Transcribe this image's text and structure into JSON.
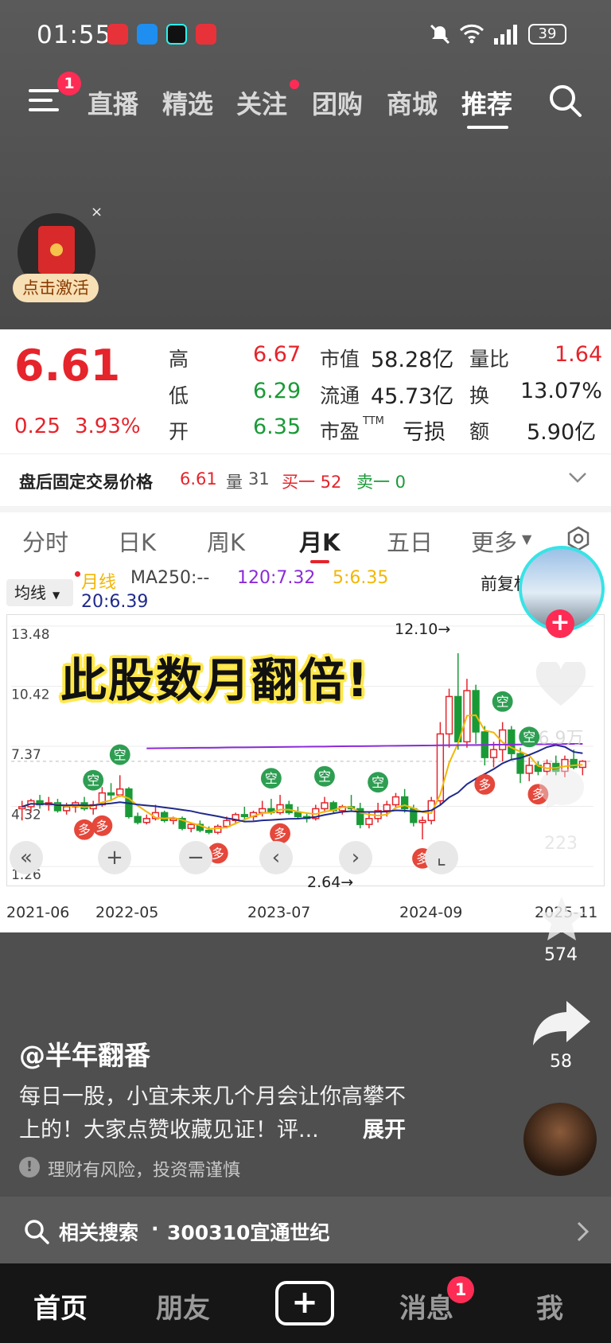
{
  "status": {
    "time": "01:55",
    "battery": "39"
  },
  "nav": {
    "tabs": [
      "直播",
      "精选",
      "关注",
      "团购",
      "商城",
      "推荐"
    ],
    "menu_badge": "1"
  },
  "promo": {
    "label": "点击激活"
  },
  "quote": {
    "price": "6.61",
    "change": "0.25",
    "change_pct": "3.93%",
    "high_label": "高",
    "high": "6.67",
    "low_label": "低",
    "low": "6.29",
    "open_label": "开",
    "open": "6.35",
    "mcap_label": "市值",
    "mcap": "58.28亿",
    "float_label": "流通",
    "float": "45.73亿",
    "pe_label": "市盈",
    "pe_sup": "TTM",
    "pe": "亏损",
    "vr_label": "量比",
    "vr": "1.64",
    "turn_label": "换",
    "turn": "13.07%",
    "amt_label": "额",
    "amt": "5.90亿"
  },
  "afterhours": {
    "label": "盘后固定交易价格",
    "price": "6.61",
    "vol_label": "量",
    "vol": "31",
    "bid": "买一 52",
    "ask": "卖一 0"
  },
  "chart_tabs": [
    "分时",
    "日K",
    "周K",
    "月K",
    "五日",
    "更多"
  ],
  "ma": {
    "selector": "均线",
    "line_label": "月线",
    "ma250": "MA250:--",
    "ma120": "120:7.32",
    "ma5": "5:6.35",
    "ma20": "20:6.39",
    "fq": "前复权"
  },
  "chart_data": {
    "type": "candlestick",
    "y_ticks": [
      "13.48",
      "10.42",
      "7.37",
      "4.32",
      "1.26"
    ],
    "ylim": [
      1.26,
      13.48
    ],
    "x_ticks": [
      "2021-06",
      "2022-05",
      "2023-07",
      "2024-09",
      "2025-11"
    ],
    "max_label": "12.10→",
    "min_label": "2.64→",
    "max": 12.1,
    "min": 2.64,
    "candles": [
      [
        4.2,
        4.6,
        3.6,
        4.3
      ],
      [
        4.3,
        4.7,
        4.0,
        4.6
      ],
      [
        4.6,
        4.9,
        4.2,
        4.4
      ],
      [
        4.4,
        4.8,
        4.1,
        4.5
      ],
      [
        4.5,
        4.7,
        4.0,
        4.1
      ],
      [
        4.1,
        4.5,
        3.9,
        4.3
      ],
      [
        4.3,
        4.6,
        4.0,
        4.5
      ],
      [
        4.5,
        4.8,
        4.1,
        4.2
      ],
      [
        4.2,
        4.6,
        3.9,
        4.4
      ],
      [
        4.4,
        5.3,
        4.3,
        5.0
      ],
      [
        5.0,
        5.5,
        4.6,
        4.9
      ],
      [
        4.9,
        5.9,
        4.8,
        5.2
      ],
      [
        5.2,
        5.3,
        3.7,
        3.8
      ],
      [
        3.8,
        4.0,
        3.4,
        3.5
      ],
      [
        3.5,
        3.9,
        3.4,
        3.7
      ],
      [
        3.7,
        4.4,
        3.6,
        4.0
      ],
      [
        4.0,
        4.1,
        3.5,
        3.6
      ],
      [
        3.6,
        3.8,
        3.4,
        3.7
      ],
      [
        3.7,
        3.8,
        3.1,
        3.2
      ],
      [
        3.2,
        3.5,
        3.0,
        3.4
      ],
      [
        3.4,
        3.6,
        3.0,
        3.1
      ],
      [
        3.1,
        3.3,
        2.9,
        3.0
      ],
      [
        3.0,
        3.4,
        2.9,
        3.3
      ],
      [
        3.3,
        3.8,
        3.2,
        3.6
      ],
      [
        3.6,
        4.0,
        3.4,
        3.9
      ],
      [
        3.9,
        4.3,
        3.6,
        3.8
      ],
      [
        3.8,
        4.1,
        3.6,
        4.0
      ],
      [
        4.0,
        4.6,
        3.8,
        4.2
      ],
      [
        4.2,
        4.7,
        3.9,
        4.0
      ],
      [
        4.0,
        4.9,
        3.9,
        4.4
      ],
      [
        4.4,
        4.6,
        3.9,
        4.0
      ],
      [
        4.0,
        4.3,
        3.7,
        3.8
      ],
      [
        3.8,
        4.0,
        3.5,
        3.7
      ],
      [
        3.7,
        4.4,
        3.6,
        4.2
      ],
      [
        4.2,
        4.8,
        4.0,
        4.5
      ],
      [
        4.5,
        4.6,
        4.0,
        4.1
      ],
      [
        4.1,
        4.4,
        3.9,
        4.3
      ],
      [
        4.3,
        4.9,
        4.1,
        4.2
      ],
      [
        4.2,
        4.5,
        3.2,
        3.4
      ],
      [
        3.4,
        4.0,
        3.2,
        3.7
      ],
      [
        3.7,
        4.5,
        3.5,
        4.1
      ],
      [
        4.1,
        4.6,
        3.8,
        4.4
      ],
      [
        4.4,
        5.0,
        4.2,
        4.8
      ],
      [
        4.8,
        5.2,
        4.0,
        4.2
      ],
      [
        4.2,
        4.4,
        3.3,
        3.5
      ],
      [
        3.5,
        3.8,
        2.64,
        3.6
      ],
      [
        3.6,
        4.8,
        3.4,
        4.6
      ],
      [
        4.6,
        8.6,
        4.4,
        8.0
      ],
      [
        8.0,
        10.3,
        7.3,
        9.9
      ],
      [
        9.9,
        12.1,
        7.2,
        7.6
      ],
      [
        7.6,
        10.8,
        7.3,
        10.2
      ],
      [
        10.2,
        10.5,
        7.5,
        8.1
      ],
      [
        8.1,
        8.4,
        6.4,
        6.8
      ],
      [
        6.8,
        7.6,
        6.3,
        7.2
      ],
      [
        7.2,
        8.6,
        6.6,
        8.2
      ],
      [
        8.2,
        8.4,
        6.7,
        7.0
      ],
      [
        7.0,
        7.3,
        5.5,
        6.0
      ],
      [
        6.0,
        6.8,
        5.6,
        6.4
      ],
      [
        6.4,
        6.6,
        5.9,
        6.1
      ],
      [
        6.1,
        6.7,
        5.9,
        6.5
      ],
      [
        6.5,
        6.9,
        5.9,
        6.1
      ],
      [
        6.1,
        6.9,
        5.8,
        6.7
      ],
      [
        6.7,
        7.2,
        6.2,
        6.3
      ],
      [
        6.3,
        6.67,
        5.9,
        6.61
      ]
    ],
    "ma_series": [
      {
        "name": "5",
        "color": "#f2b705"
      },
      {
        "name": "20",
        "color": "#1f2a8c"
      },
      {
        "name": "120",
        "color": "#8b2bd9"
      }
    ],
    "signal_labels": {
      "buy": "多",
      "sell": "空"
    }
  },
  "overlay": {
    "title": "此股数月翻倍!"
  },
  "side": {
    "likes": "6.9万",
    "comments": "223",
    "favorites": "574",
    "shares": "58"
  },
  "post": {
    "author": "@半年翻番",
    "text_line1": "每日一股，小宜未来几个月会让你高攀不",
    "text_line2": "上的！大家点赞收藏见证！评...",
    "expand": "展开",
    "risk": "理财有风险，投资需谨慎"
  },
  "search": {
    "prefix": "相关搜索",
    "sep": "·",
    "query": "300310宜通世纪"
  },
  "bottom": {
    "home": "首页",
    "friends": "朋友",
    "messages": "消息",
    "me": "我",
    "msg_badge": "1"
  }
}
